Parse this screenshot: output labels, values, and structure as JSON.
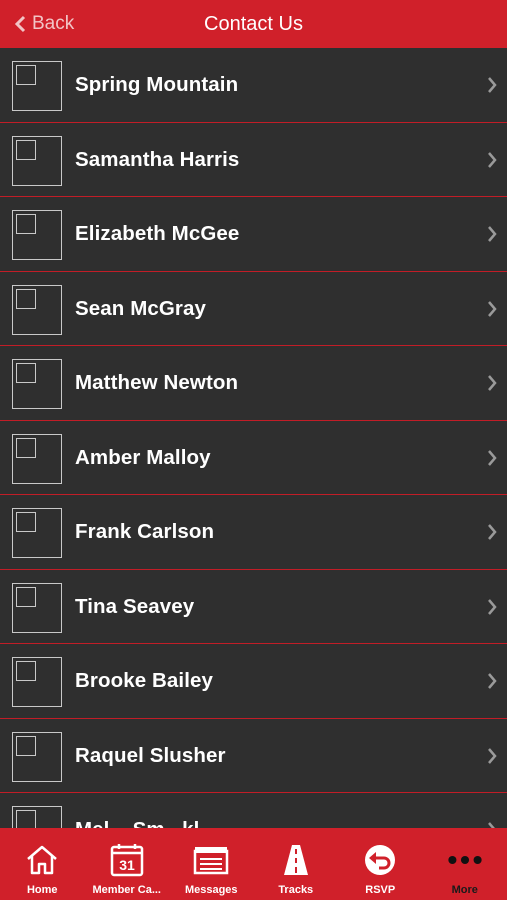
{
  "navbar": {
    "back_label": "Back",
    "title": "Contact Us"
  },
  "contacts": [
    {
      "name": "Spring Mountain"
    },
    {
      "name": "Samantha Harris"
    },
    {
      "name": "Elizabeth McGee"
    },
    {
      "name": "Sean McGray"
    },
    {
      "name": "Matthew Newton"
    },
    {
      "name": "Amber Malloy"
    },
    {
      "name": "Frank Carlson"
    },
    {
      "name": "Tina Seavey"
    },
    {
      "name": "Brooke Bailey"
    },
    {
      "name": "Raquel Slusher"
    },
    {
      "name": "Mel... Sm...kl..."
    }
  ],
  "tabbar": {
    "tabs": [
      {
        "label": "Home",
        "icon": "home-icon"
      },
      {
        "label": "Member Ca...",
        "icon": "calendar-icon",
        "badge": "31"
      },
      {
        "label": "Messages",
        "icon": "messages-icon"
      },
      {
        "label": "Tracks",
        "icon": "road-icon"
      },
      {
        "label": "RSVP",
        "icon": "rsvp-icon"
      },
      {
        "label": "More",
        "icon": "more-icon"
      }
    ],
    "selected": "More"
  },
  "colors": {
    "accent": "#d0202a",
    "list_background": "#2f2f2f",
    "separator": "#c21d27"
  }
}
